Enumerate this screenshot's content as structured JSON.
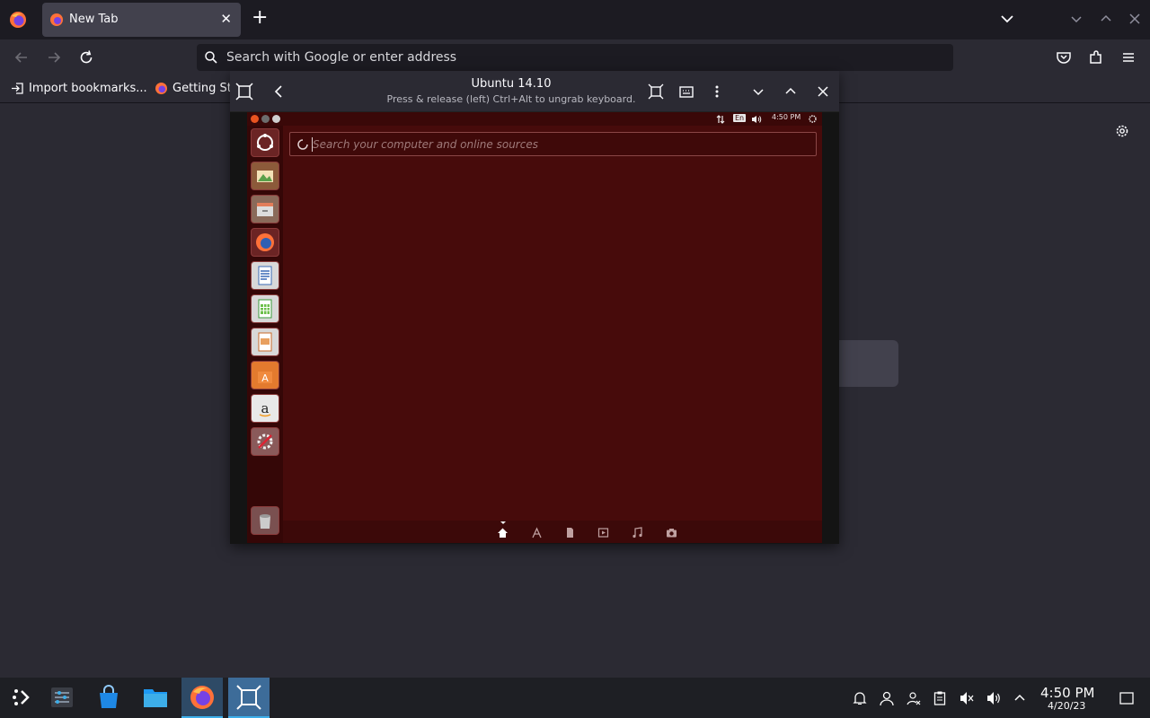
{
  "browser": {
    "tab": {
      "title": "New Tab",
      "close": "✕"
    },
    "new_tab": "+",
    "url_placeholder": "Search with Google or enter address",
    "bookmarks": [
      {
        "label": "Import bookmarks..."
      },
      {
        "label": "Getting St"
      }
    ]
  },
  "vm": {
    "title": "Ubuntu 14.10",
    "subtitle": "Press & release (left) Ctrl+Alt to ungrab keyboard.",
    "guest": {
      "panel": {
        "keyboard": "En",
        "time": "4:50 PM"
      },
      "search_placeholder": "Search your computer and online sources",
      "launcher_icons": [
        "dash-home-icon",
        "photo-shotwell-icon",
        "files-icon",
        "firefox-icon",
        "writer-icon",
        "calc-icon",
        "impress-icon",
        "software-center-icon",
        "amazon-icon",
        "system-settings-icon",
        "trash-icon"
      ],
      "lenses": [
        "home-lens-icon",
        "apps-lens-icon",
        "files-lens-icon",
        "video-lens-icon",
        "music-lens-icon",
        "photo-lens-icon"
      ]
    }
  },
  "taskbar": {
    "clock_time": "4:50 PM",
    "clock_date": "4/20/23"
  },
  "colors": {
    "ubuntu_bg": "#470b0b",
    "taskbar_active": "#3daee9",
    "browser_bg": "#2b2a33"
  }
}
